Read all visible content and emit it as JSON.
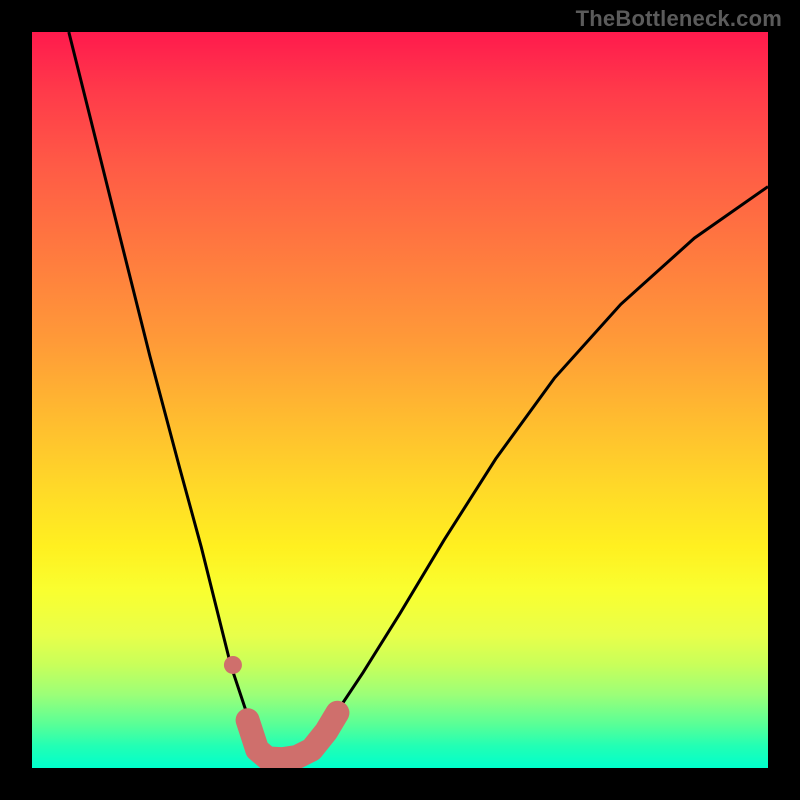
{
  "watermark": "TheBottleneck.com",
  "colors": {
    "frame": "#000000",
    "curve": "#000000",
    "marker_stroke": "#cf6f6c",
    "marker_fill": "#cf6f6c",
    "gradient_top": "#ff1a4d",
    "gradient_bottom": "#00ffcc"
  },
  "chart_data": {
    "type": "line",
    "title": "",
    "xlabel": "",
    "ylabel": "",
    "xlim": [
      0,
      100
    ],
    "ylim": [
      0,
      100
    ],
    "grid": false,
    "legend": false,
    "series": [
      {
        "name": "bottleneck-curve",
        "x": [
          5,
          8,
          12,
          16,
          20,
          23,
          25,
          27,
          29,
          30.5,
          32,
          34,
          36,
          38,
          41,
          45,
          50,
          56,
          63,
          71,
          80,
          90,
          100
        ],
        "values": [
          100,
          88,
          72,
          56,
          41,
          30,
          22,
          14,
          8,
          4,
          1.5,
          1,
          1.5,
          3,
          7,
          13,
          21,
          31,
          42,
          53,
          63,
          72,
          79
        ]
      }
    ],
    "markers": [
      {
        "name": "dot-left",
        "x": 27.3,
        "y": 14
      },
      {
        "name": "band-left-top",
        "x": 29.3,
        "y": 6.5
      },
      {
        "name": "band-left-bottom",
        "x": 30.6,
        "y": 2.5
      },
      {
        "name": "band-floor-a",
        "x": 32,
        "y": 1.3
      },
      {
        "name": "band-floor-b",
        "x": 34,
        "y": 1.2
      },
      {
        "name": "band-floor-c",
        "x": 36,
        "y": 1.5
      },
      {
        "name": "band-right-a",
        "x": 38,
        "y": 2.5
      },
      {
        "name": "band-right-b",
        "x": 40,
        "y": 5
      },
      {
        "name": "band-right-c",
        "x": 41.5,
        "y": 7.5
      }
    ]
  }
}
